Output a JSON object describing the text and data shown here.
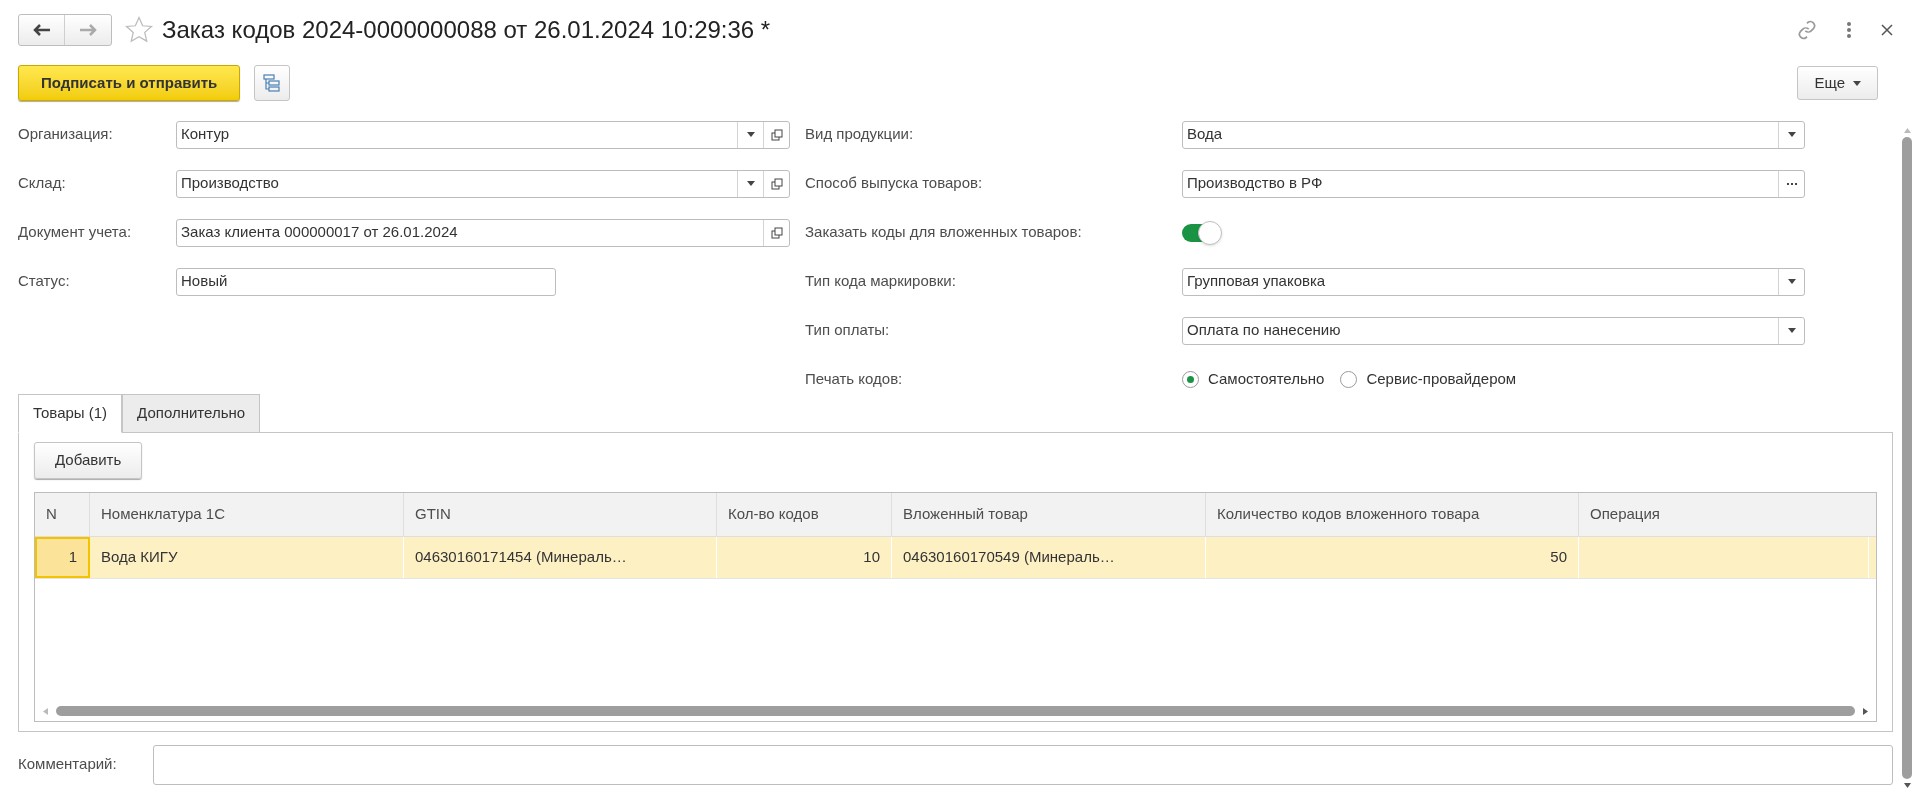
{
  "window": {
    "title": "Заказ кодов 2024-0000000088 от 26.01.2024 10:29:36 *",
    "favorite": false
  },
  "toolbar": {
    "primary": "Подписать и отправить",
    "more": "Еще"
  },
  "left_fields": [
    {
      "label": "Организация:",
      "value": "Контур",
      "kind": "select-open"
    },
    {
      "label": "Склад:",
      "value": "Производство",
      "kind": "select-open"
    },
    {
      "label": "Документ учета:",
      "value": "Заказ клиента 000000017 от 26.01.2024",
      "kind": "open"
    },
    {
      "label": "Статус:",
      "value": "Новый",
      "kind": "text"
    }
  ],
  "right_fields": [
    {
      "label": "Вид продукции:",
      "value": "Вода",
      "kind": "select"
    },
    {
      "label": "Способ выпуска товаров:",
      "value": "Производство в РФ",
      "kind": "choice"
    },
    {
      "label": "Заказать коды для вложенных товаров:",
      "kind": "toggle",
      "on": true
    },
    {
      "label": "Тип кода маркировки:",
      "value": "Групповая упаковка",
      "kind": "select"
    },
    {
      "label": "Тип оплаты:",
      "value": "Оплата по нанесению",
      "kind": "select"
    },
    {
      "label": "Печать кодов:",
      "kind": "radio",
      "options": [
        {
          "label": "Самостоятельно",
          "selected": true
        },
        {
          "label": "Сервис-провайдером",
          "selected": false
        }
      ]
    }
  ],
  "tabs": [
    {
      "label": "Товары (1)",
      "selected": true
    },
    {
      "label": "Дополнительно",
      "selected": false
    }
  ],
  "add_button": "Добавить",
  "table": {
    "columns": [
      "N",
      "Номенклатура 1С",
      "GTIN",
      "Кол-во кодов",
      "Вложенный товар",
      "Количество кодов вложенного товара",
      "Операция"
    ],
    "rows": [
      {
        "selected": true,
        "cells": [
          "1",
          "Вода КИГУ",
          "04630160171454 (Минераль…",
          "10",
          "04630160170549 (Минераль…",
          "50",
          ""
        ]
      }
    ]
  },
  "comment": {
    "label": "Комментарий:"
  }
}
